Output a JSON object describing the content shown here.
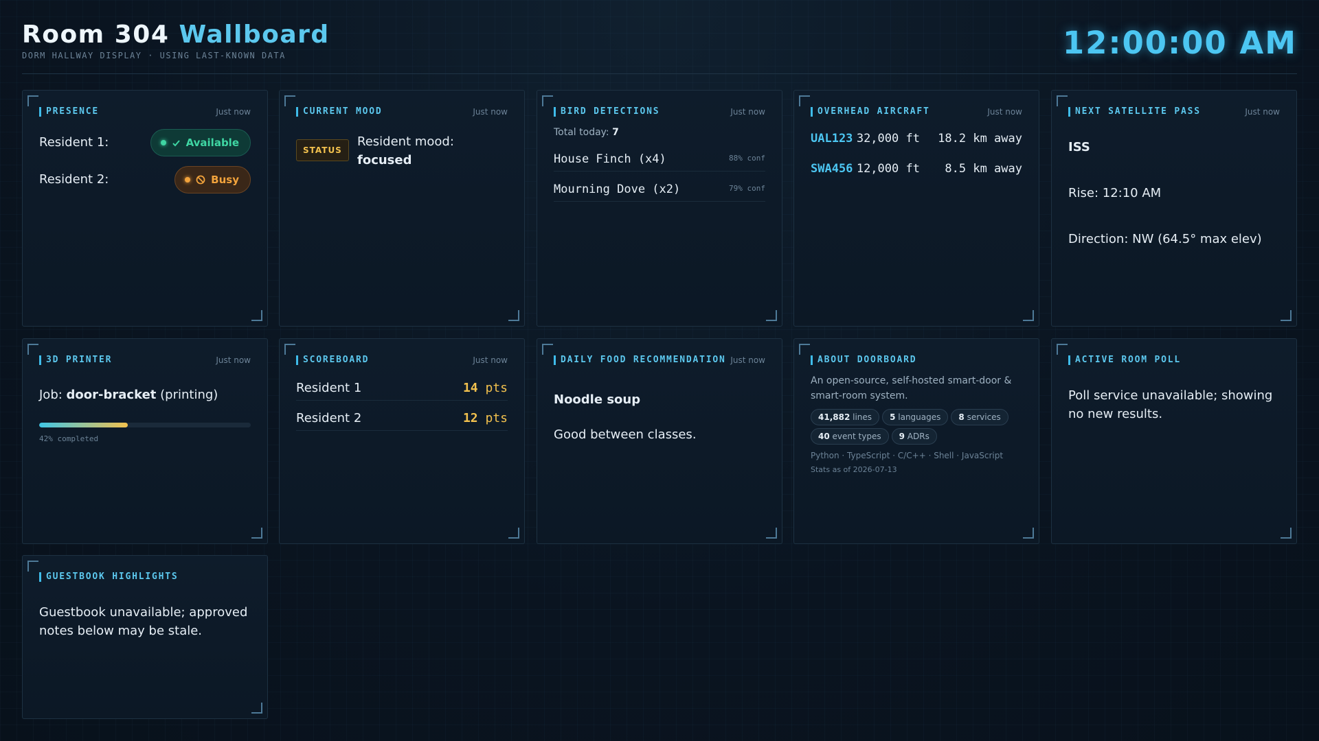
{
  "header": {
    "title_main": "Room 304",
    "title_accent": "Wallboard",
    "subtitle": "DORM HALLWAY DISPLAY · USING LAST-KNOWN DATA",
    "clock": "12:00:00 AM"
  },
  "presence": {
    "title": "PRESENCE",
    "time": "Just now",
    "residents": [
      {
        "name": "Resident 1:",
        "status": "Available",
        "icon": "check-icon"
      },
      {
        "name": "Resident 2:",
        "status": "Busy",
        "icon": "no-entry-icon"
      }
    ]
  },
  "mood": {
    "title": "CURRENT MOOD",
    "time": "Just now",
    "chip": "STATUS",
    "label": "Resident mood:",
    "value": "focused"
  },
  "birds": {
    "title": "BIRD DETECTIONS",
    "time": "Just now",
    "total_label": "Total today:",
    "total": "7",
    "items": [
      {
        "name": "House Finch (x4)",
        "conf": "88% conf"
      },
      {
        "name": "Mourning Dove (x2)",
        "conf": "79% conf"
      }
    ]
  },
  "aircraft": {
    "title": "OVERHEAD AIRCRAFT",
    "time": "Just now",
    "items": [
      {
        "callsign": "UAL123",
        "alt": "32,000 ft",
        "dist": "18.2 km away"
      },
      {
        "callsign": "SWA456",
        "alt": "12,000 ft",
        "dist": "8.5 km away"
      }
    ]
  },
  "satellite": {
    "title": "NEXT SATELLITE PASS",
    "time": "Just now",
    "name": "ISS",
    "rise": "Rise: 12:10 AM",
    "direction": "Direction: NW (64.5° max elev)"
  },
  "printer": {
    "title": "3D PRINTER",
    "time": "Just now",
    "job_label": "Job:",
    "job_name": "door-bracket",
    "job_state": "(printing)",
    "progress": 0.42,
    "progress_text": "42% completed"
  },
  "scoreboard": {
    "title": "SCOREBOARD",
    "time": "Just now",
    "rows": [
      {
        "name": "Resident 1",
        "score": "14",
        "unit": "pts"
      },
      {
        "name": "Resident 2",
        "score": "12",
        "unit": "pts"
      }
    ]
  },
  "food": {
    "title": "DAILY FOOD RECOMMENDATION",
    "time": "Just now",
    "dish": "Noodle soup",
    "note": "Good between classes."
  },
  "about": {
    "title": "ABOUT DOORBOARD",
    "description": "An open-source, self-hosted smart-door & smart-room system.",
    "tags": [
      {
        "value": "41,882",
        "label": "lines"
      },
      {
        "value": "5",
        "label": "languages"
      },
      {
        "value": "8",
        "label": "services"
      },
      {
        "value": "40",
        "label": "event types"
      },
      {
        "value": "9",
        "label": "ADRs"
      }
    ],
    "languages": "Python · TypeScript · C/C++ · Shell · JavaScript",
    "stats_date": "Stats as of 2026-07-13"
  },
  "poll": {
    "title": "ACTIVE ROOM POLL",
    "message": "Poll service unavailable; showing no new results."
  },
  "guestbook": {
    "title": "GUESTBOOK HIGHLIGHTS",
    "message": "Guestbook unavailable; approved notes below may be stale."
  },
  "colors": {
    "accent": "#5cc8ee",
    "available": "#3fd6a3",
    "busy": "#f2a33c",
    "score": "#f2c14e"
  }
}
